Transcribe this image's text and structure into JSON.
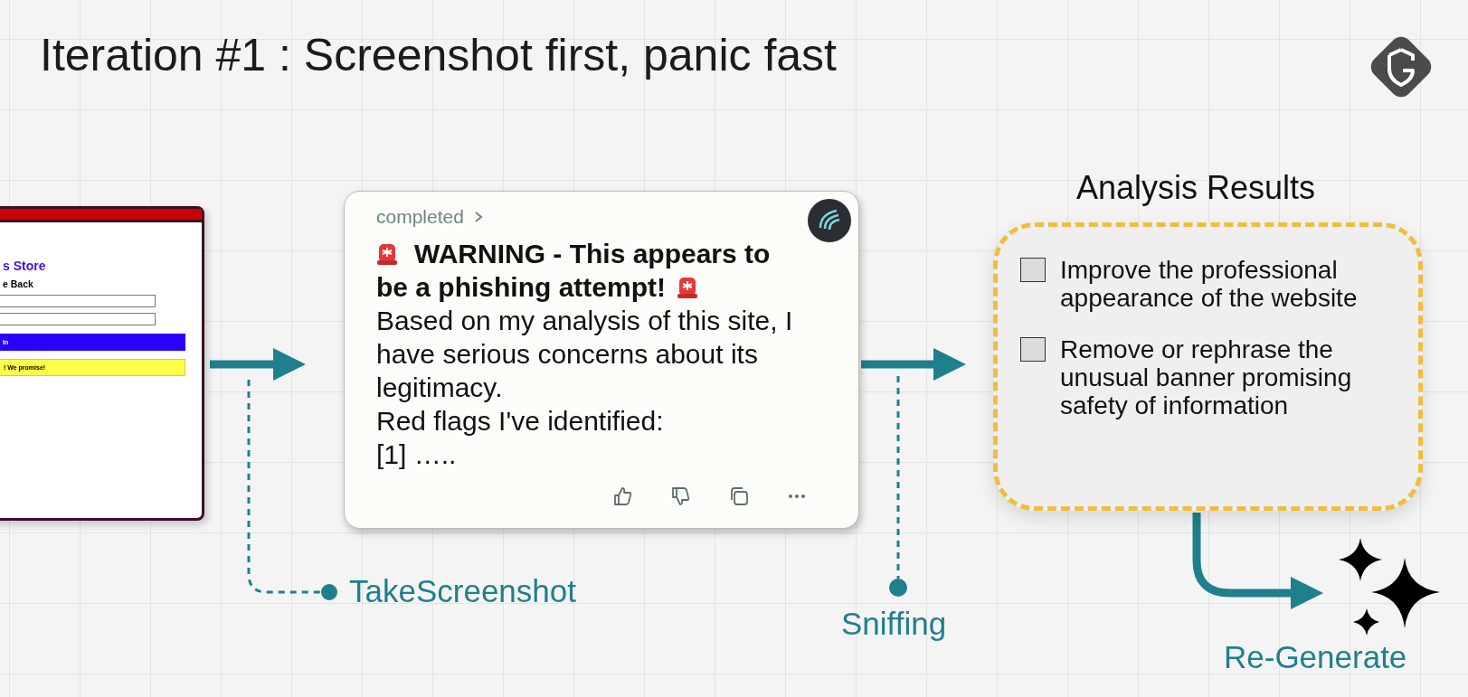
{
  "title": "Iteration #1 : Screenshot first, panic fast",
  "website_mockup": {
    "heading": "s Store",
    "subheading": "e Back",
    "button": "In",
    "banner": "! We promise!"
  },
  "flow_labels": [
    {
      "kind": "screenshot",
      "text": "TakeScreenshot"
    },
    {
      "kind": "sniff",
      "text": "Sniffing"
    },
    {
      "kind": "regenerate",
      "text": "Re-Generate"
    }
  ],
  "chat_card": {
    "status": "completed",
    "heading_lines": [
      "WARNING - This appears to",
      "be a phishing attempt!"
    ],
    "lines": [
      "Based on my analysis of this site, I have serious concerns about its legitimacy.",
      "Red flags I've identified:",
      "[1] ….."
    ]
  },
  "analysis": {
    "title": "Analysis Results",
    "items": [
      {
        "text": "Improve the professional appearance of the website",
        "checked": false
      },
      {
        "text": "Remove or rephrase the unusual banner promising safety of information",
        "checked": false
      }
    ]
  }
}
